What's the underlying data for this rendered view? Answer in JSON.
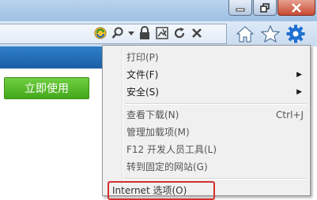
{
  "menu": {
    "items": [
      {
        "label": "打印(P)",
        "submenu": false,
        "shortcut": ""
      },
      {
        "label": "文件(F)",
        "submenu": true,
        "shortcut": ""
      },
      {
        "label": "安全(S)",
        "submenu": true,
        "shortcut": ""
      },
      {
        "label": "查看下载(N)",
        "submenu": false,
        "shortcut": "Ctrl+J"
      },
      {
        "label": "管理加载项(M)",
        "submenu": false,
        "shortcut": ""
      },
      {
        "label": "F12 开发人员工具(L)",
        "submenu": false,
        "shortcut": ""
      },
      {
        "label": "转到固定的网站(G)",
        "submenu": false,
        "shortcut": ""
      },
      {
        "label": "Internet 选项(O)",
        "submenu": false,
        "shortcut": ""
      }
    ],
    "submenu_arrow": "▶"
  },
  "page": {
    "green_button_label": "立即使用"
  },
  "icons": {
    "window": [
      "minimize-icon",
      "restore-icon",
      "close-icon"
    ],
    "address_bar": [
      "compatibility-view-icon",
      "search-icon",
      "dropdown-icon",
      "lock-icon",
      "broken-image-icon",
      "refresh-icon",
      "stop-icon"
    ],
    "toolbar": [
      "home-icon",
      "favorites-star-icon",
      "settings-gear-icon"
    ]
  },
  "colors": {
    "accent_blue": "#1e6fd0",
    "green_button": "#4cb424",
    "highlight_red": "#d42f2f"
  }
}
